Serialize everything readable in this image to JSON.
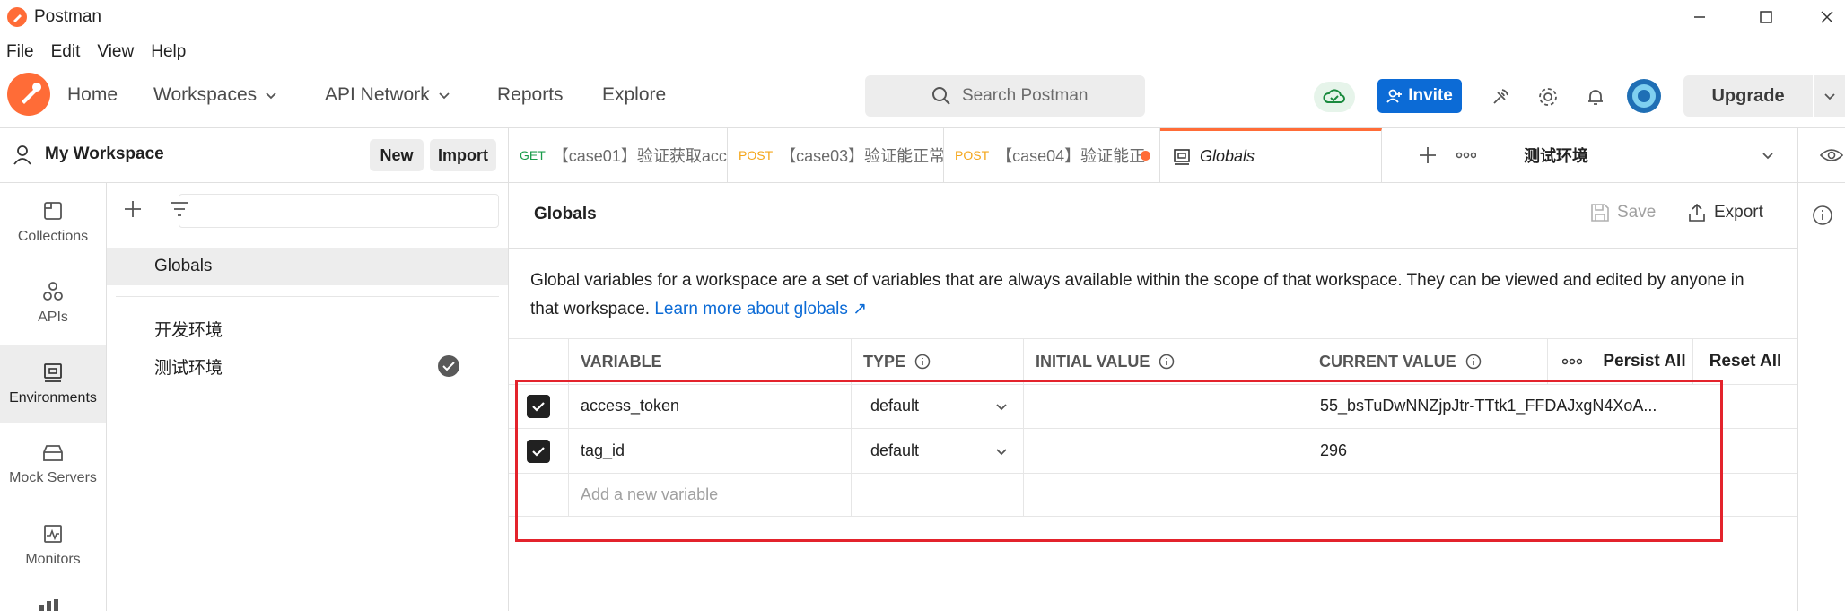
{
  "window": {
    "title": "Postman"
  },
  "menu": [
    "File",
    "Edit",
    "View",
    "Help"
  ],
  "nav": {
    "home": "Home",
    "workspaces": "Workspaces",
    "api_network": "API Network",
    "reports": "Reports",
    "explore": "Explore"
  },
  "search": {
    "placeholder": "Search Postman"
  },
  "header": {
    "invite": "Invite",
    "upgrade": "Upgrade"
  },
  "workspace": {
    "name": "My Workspace",
    "new": "New",
    "import": "Import"
  },
  "rail": [
    "Collections",
    "APIs",
    "Environments",
    "Mock Servers",
    "Monitors"
  ],
  "envlist": {
    "globals": "Globals",
    "items": [
      "开发环境",
      "测试环境"
    ]
  },
  "tabs": [
    {
      "method": "GET",
      "label": "【case01】验证获取acc"
    },
    {
      "method": "POST",
      "label": "【case03】验证能正常"
    },
    {
      "method": "POST",
      "label": "【case04】验证能正"
    },
    {
      "label": "Globals"
    }
  ],
  "env_selector": "测试环境",
  "panel": {
    "title": "Globals",
    "save": "Save",
    "export": "Export",
    "desc": "Global variables for a workspace are a set of variables that are always available within the scope of that workspace. They can be viewed and edited by anyone in that workspace.",
    "learn_more": "Learn more about globals ↗"
  },
  "table": {
    "headers": {
      "variable": "VARIABLE",
      "type": "TYPE",
      "initial": "INITIAL VALUE",
      "current": "CURRENT VALUE",
      "persist": "Persist All",
      "reset": "Reset All"
    },
    "rows": [
      {
        "variable": "access_token",
        "type": "default",
        "initial": "",
        "current": "55_bsTuDwNNZjpJtr-TTtk1_FFDAJxgN4XoA..."
      },
      {
        "variable": "tag_id",
        "type": "default",
        "initial": "",
        "current": "296"
      }
    ],
    "add_placeholder": "Add a new variable"
  },
  "colors": {
    "accent": "#ff6c37",
    "primary": "#0c6bd6",
    "highlight": "#e3232c"
  }
}
